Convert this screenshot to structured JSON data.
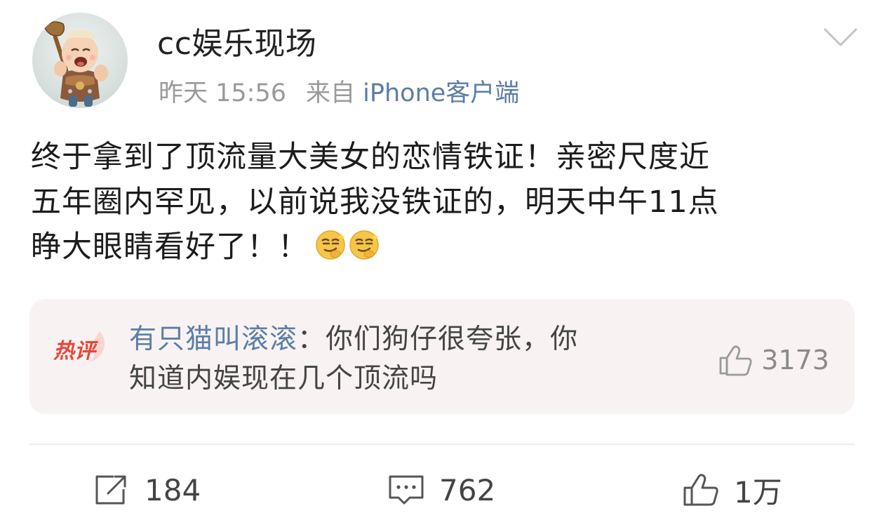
{
  "post": {
    "author": "cc娱乐现场",
    "time": "昨天 15:56",
    "source_prefix": "来自",
    "source": "iPhone客户端",
    "text_lines": [
      "终于拿到了顶流量大美女的恋情铁证！亲密尺度近",
      "五年圈内罕见，以前说我没铁证的，明天中午11点",
      "睁大眼睛看好了！！"
    ],
    "emoji_names": [
      "smirk-emoji",
      "smirk-emoji"
    ]
  },
  "hot_comment": {
    "badge": "热评",
    "user": "有只猫叫滚滚",
    "separator": "：",
    "text_line1": "你们狗仔很夸张，你",
    "text_line2": "知道内娱现在几个顶流吗",
    "likes": "3173"
  },
  "actions": {
    "reposts": "184",
    "comments": "762",
    "likes": "1万"
  },
  "colors": {
    "link": "#5b7ea6",
    "meta": "#9a9a9a",
    "hot_badge": "#e8463a",
    "card_bg": "#f8f3f2"
  }
}
